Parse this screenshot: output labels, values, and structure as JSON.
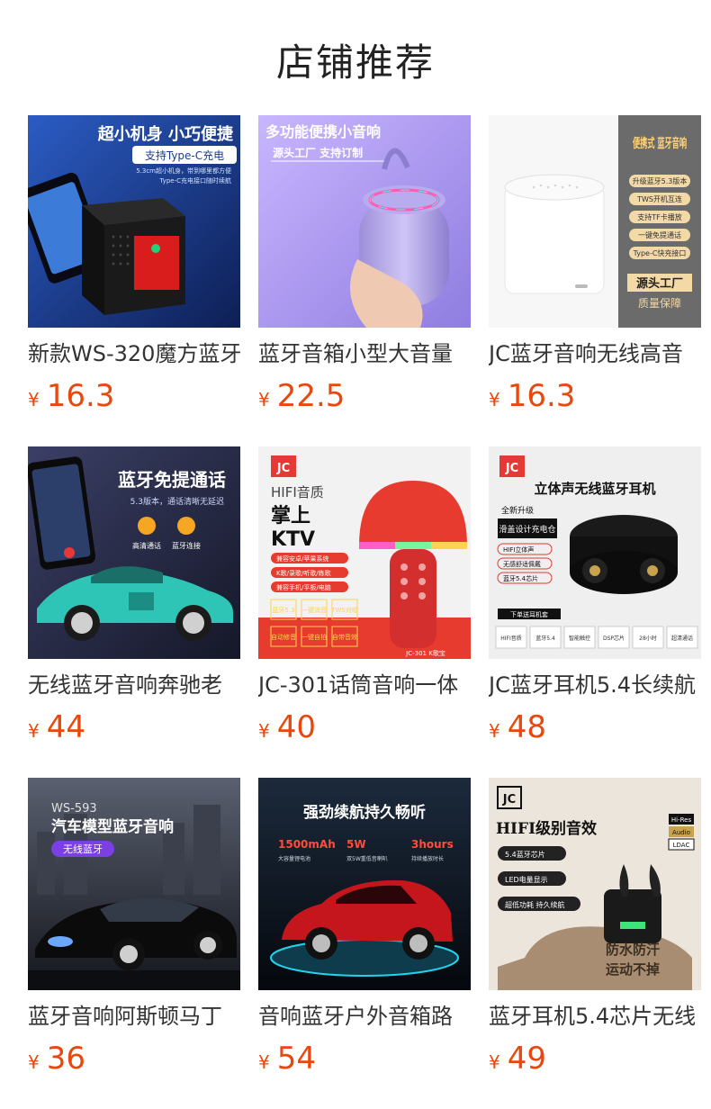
{
  "section": {
    "title": "店铺推荐"
  },
  "products": [
    {
      "name": "新款WS-320魔方蓝牙",
      "currency": "¥",
      "price": "16.3",
      "image": {
        "icon": "cube-speaker-image",
        "bg": "#1b3d8f",
        "headline": "超小机身 小巧便捷",
        "badge": "支持Type-C充电",
        "lines": [
          "5.3cm超小机身，带到哪里都方便",
          "Type-C充电接口随时续航"
        ]
      }
    },
    {
      "name": "蓝牙音箱小型大音量",
      "currency": "¥",
      "price": "22.5",
      "image": {
        "icon": "fabric-speaker-image",
        "bg": "#b7a9f0",
        "headline": "多功能便携小音响",
        "badge": "源头工厂  支持订制"
      }
    },
    {
      "name": "JC蓝牙音响无线高音",
      "currency": "¥",
      "price": "16.3",
      "image": {
        "icon": "white-speaker-image",
        "bg": "#f4f4f4",
        "headline": "便携式 蓝牙音响",
        "features": [
          "升级蓝牙5.3版本",
          "TWS开机互连",
          "支持TF卡播放",
          "一键免提通话",
          "Type-C快充接口"
        ],
        "badge": "源头工厂",
        "badge2": "质量保障"
      }
    },
    {
      "name": "无线蓝牙音响奔驰老",
      "currency": "¥",
      "price": "44",
      "image": {
        "icon": "car-speaker-image",
        "bg": "#2a2f4d",
        "headline": "蓝牙免提通话",
        "lines": [
          "5.3版本，通话清晰无延迟"
        ],
        "labels": [
          "高清通话",
          "蓝牙连接"
        ]
      }
    },
    {
      "name": "JC-301话筒音响一体",
      "currency": "¥",
      "price": "40",
      "image": {
        "icon": "mushroom-speaker-image",
        "bg": "#f1f1f1",
        "brand": "JC",
        "headline": "HIFI音质",
        "headline2": "掌上",
        "headline3": "KTV",
        "features": [
          "兼容安卓/苹果系统",
          "K歌/录歌/听歌/练歌",
          "兼容手机/平板/电脑"
        ],
        "chips": [
          "蓝牙5.3",
          "一键消音",
          "TWS对唱",
          "自动修音",
          "一键自拍",
          "自带音效"
        ],
        "model": "JC-301 K歌宝"
      }
    },
    {
      "name": "JC蓝牙耳机5.4长续航",
      "currency": "¥",
      "price": "48",
      "image": {
        "icon": "earbuds-image",
        "bg": "#efefef",
        "brand": "JC",
        "headline": "立体声无线蓝牙耳机",
        "badge": "全新升级",
        "badge2": "滑盖设计充电仓",
        "features": [
          "HIFI立体声",
          "无感舒适佩戴",
          "蓝牙5.4芯片"
        ],
        "chips": [
          "HIFI音质",
          "蓝牙5.4",
          "智能触控",
          "DSP芯片",
          "28小时",
          "超清通话"
        ],
        "note": "下单送耳机套"
      }
    },
    {
      "name": "蓝牙音响阿斯顿马丁",
      "currency": "¥",
      "price": "36",
      "image": {
        "icon": "sports-car-speaker-image",
        "bg": "#3a3f4a",
        "model": "WS-593",
        "headline": "汽车模型蓝牙音响",
        "badge": "无线蓝牙"
      }
    },
    {
      "name": "音响蓝牙户外音箱路",
      "currency": "¥",
      "price": "54",
      "image": {
        "icon": "suv-speaker-image",
        "bg": "#0e1824",
        "headline": "强劲续航持久畅听",
        "stats": [
          "1500mAh",
          "5W",
          "3hours"
        ],
        "labels": [
          "大容量锂电池",
          "双5W重低音喇叭",
          "持续播放时长"
        ]
      }
    },
    {
      "name": "蓝牙耳机5.4芯片无线",
      "currency": "¥",
      "price": "49",
      "image": {
        "icon": "earbuds-case-image",
        "bg": "#e9e2d8",
        "brand": "JC",
        "headline": "HIFI级别音效",
        "features": [
          "5.4蓝牙芯片",
          "LED电量显示",
          "超低功耗 持久续航"
        ],
        "tags": [
          "Hi-Res",
          "Audio",
          "LDAC"
        ],
        "slogan": "防水防汗",
        "slogan2": "运动不掉"
      }
    }
  ]
}
